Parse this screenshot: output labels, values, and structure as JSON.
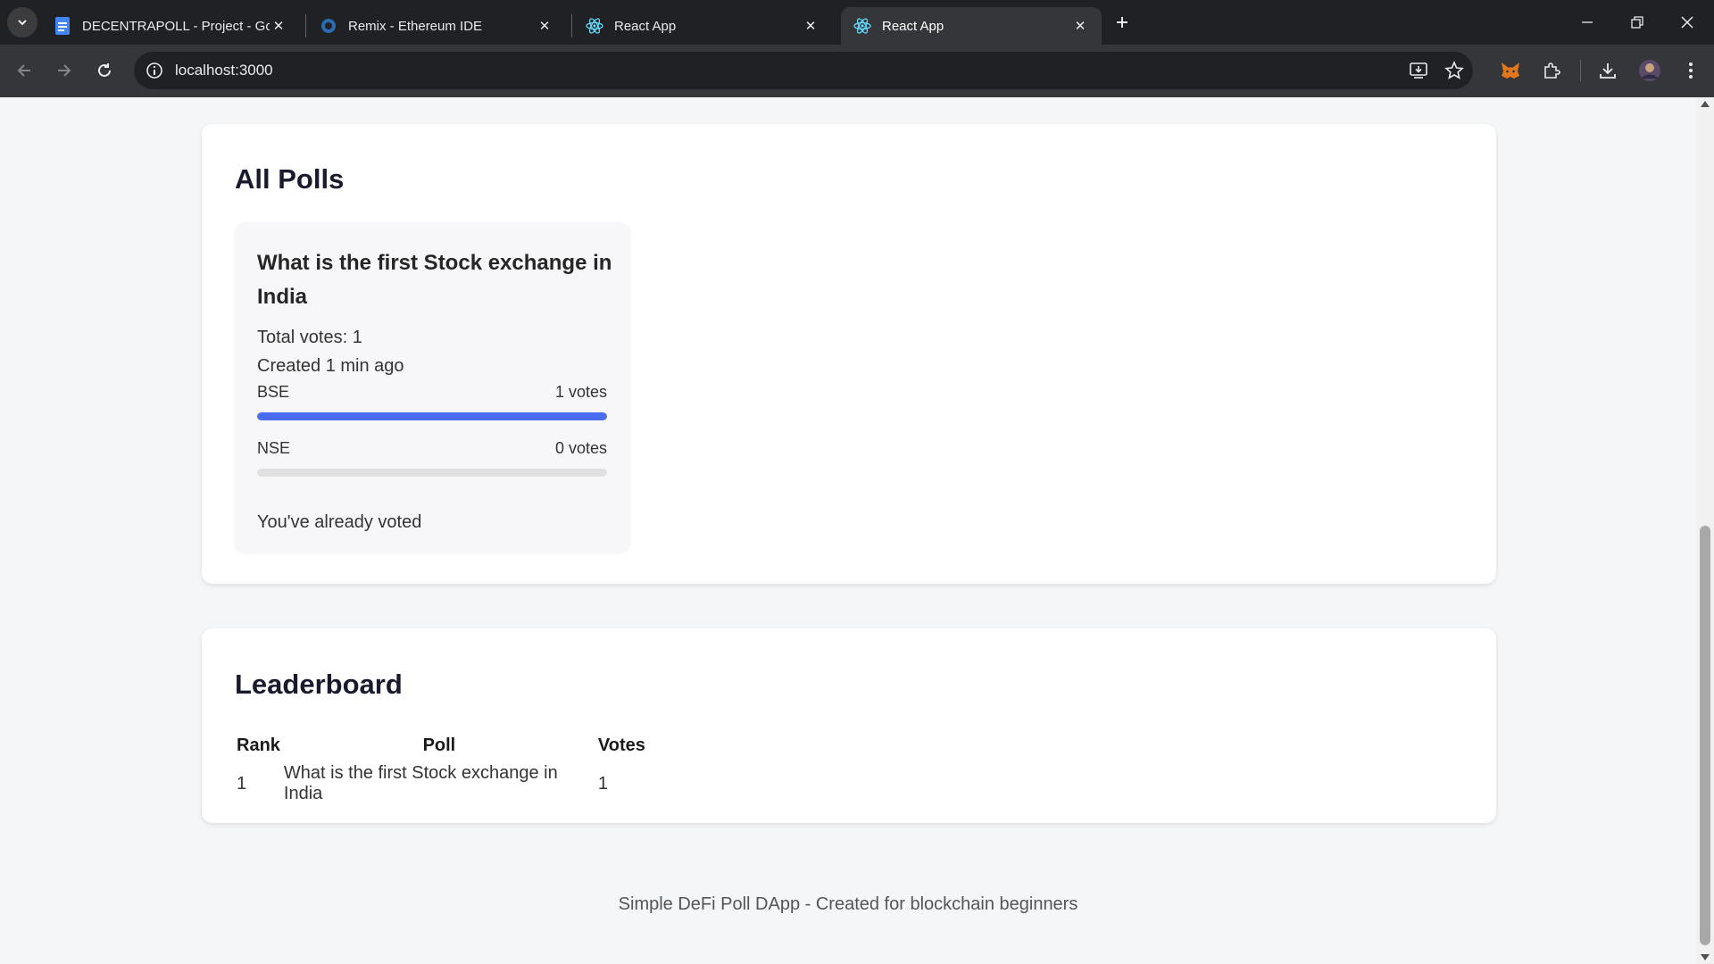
{
  "browser": {
    "tabs": [
      {
        "title": "DECENTRAPOLL - Project - Goo",
        "icon": "google-docs-icon"
      },
      {
        "title": "Remix - Ethereum IDE",
        "icon": "remix-icon"
      },
      {
        "title": "React App",
        "icon": "react-icon"
      },
      {
        "title": "React App",
        "icon": "react-icon",
        "active": true
      }
    ],
    "address": "localhost:3000"
  },
  "colors": {
    "accent": "#4a6cf0",
    "page_bg": "#f5f6f8",
    "card_bg": "#ffffff"
  },
  "polls_section": {
    "title": "All Polls",
    "polls": [
      {
        "question": "What is the first Stock exchange in India",
        "total_votes": "Total votes: 1",
        "created": "Created 1 min ago",
        "options": [
          {
            "label": "BSE",
            "votes_text": "1 votes",
            "fill_fraction": 1.0
          },
          {
            "label": "NSE",
            "votes_text": "0 votes",
            "fill_fraction": 0.0
          }
        ],
        "status": "You've already voted"
      }
    ]
  },
  "leaderboard": {
    "title": "Leaderboard",
    "columns": [
      "Rank",
      "Poll",
      "Votes"
    ],
    "rows": [
      {
        "rank": "1",
        "poll": "What is the first Stock exchange in India",
        "votes": "1"
      }
    ]
  },
  "footer": {
    "text": "Simple DeFi Poll DApp - Created for blockchain beginners"
  }
}
